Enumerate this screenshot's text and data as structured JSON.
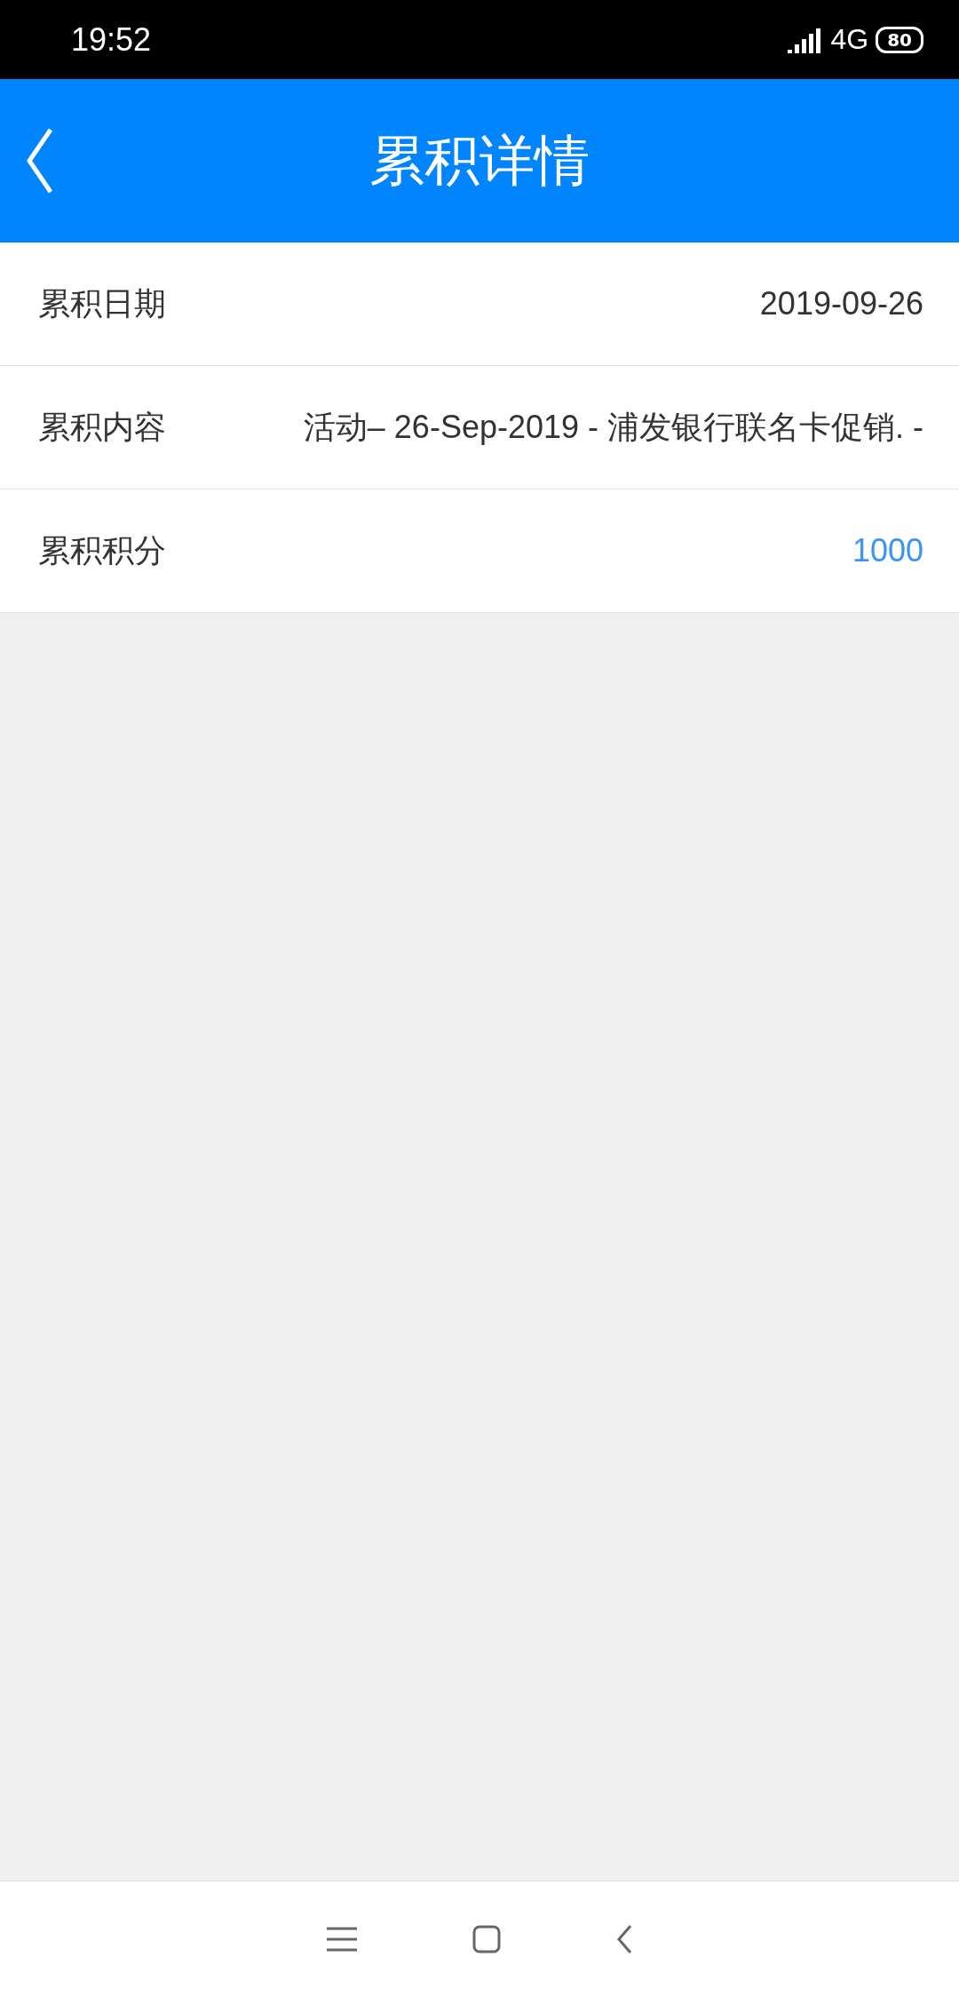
{
  "status_bar": {
    "time": "19:52",
    "network": "4G",
    "battery": "80"
  },
  "header": {
    "title": "累积详情"
  },
  "rows": [
    {
      "label": "累积日期",
      "value": "2019-09-26",
      "kind": "plain"
    },
    {
      "label": "累积内容",
      "value": "活动– 26-Sep-2019 - 浦发银行联名卡促销. -",
      "kind": "plain"
    },
    {
      "label": "累积积分",
      "value": "1000",
      "kind": "accent"
    }
  ]
}
